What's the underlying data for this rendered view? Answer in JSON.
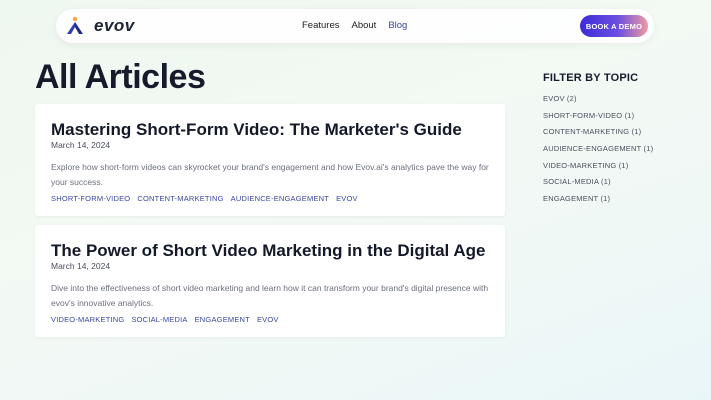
{
  "header": {
    "brand": "evov",
    "nav": [
      "Features",
      "About",
      "Blog"
    ],
    "cta": "BOOK A DEMO"
  },
  "page_title": "All Articles",
  "articles": [
    {
      "title": "Mastering Short-Form Video: The Marketer's Guide",
      "date": "March 14, 2024",
      "excerpt": "Explore how short-form videos can skyrocket your brand's engagement and how Evov.ai's analytics pave the way for your success.",
      "tags": [
        "SHORT-FORM-VIDEO",
        "CONTENT-MARKETING",
        "AUDIENCE-ENGAGEMENT",
        "EVOV"
      ]
    },
    {
      "title": "The Power of Short Video Marketing in the Digital Age",
      "date": "March 14, 2024",
      "excerpt": "Dive into the effectiveness of short video marketing and learn how it can transform your brand's digital presence with evov's innovative analytics.",
      "tags": [
        "VIDEO-MARKETING",
        "SOCIAL-MEDIA",
        "ENGAGEMENT",
        "EVOV"
      ]
    }
  ],
  "sidebar": {
    "title": "FILTER BY TOPIC",
    "topics": [
      "EVOV (2)",
      "SHORT-FORM-VIDEO (1)",
      "CONTENT-MARKETING (1)",
      "AUDIENCE-ENGAGEMENT (1)",
      "VIDEO-MARKETING (1)",
      "SOCIAL-MEDIA (1)",
      "ENGAGEMENT (1)"
    ]
  },
  "colors": {
    "accent": "#3a46a0",
    "cta_start": "#3d2bd9",
    "cta_end": "#f19aa1"
  },
  "icons": {
    "logo": "evov-logo-icon"
  }
}
